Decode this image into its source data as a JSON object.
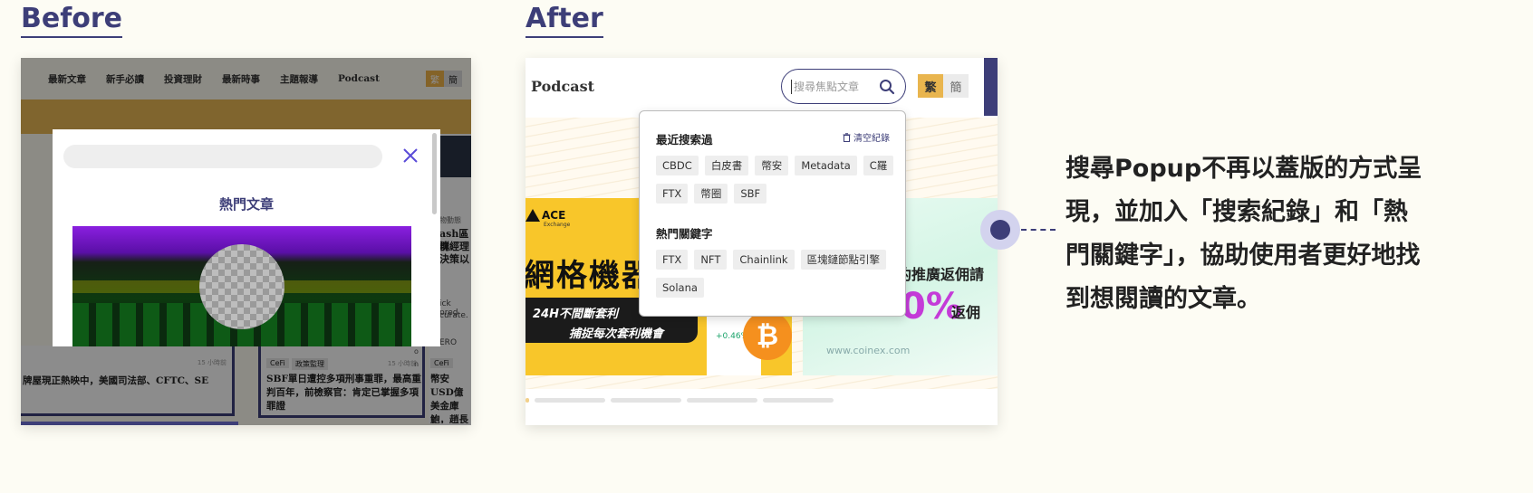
{
  "headings": {
    "before": "Before",
    "after": "After"
  },
  "before": {
    "nav": [
      "最新文章",
      "新手必讀",
      "投資理財",
      "最新時事",
      "主題報導",
      "Podcast"
    ],
    "lang": {
      "trad": "繁",
      "simp": "簡"
    },
    "modal": {
      "section_title": "熱門文章"
    },
    "side_snippets": [
      "ash區塊",
      "群經理",
      "決策以"
    ],
    "side_small": [
      "物動態",
      "ick pred",
      "curate.",
      "ERO"
    ],
    "cards": [
      {
        "time": "15 小時前",
        "title": "牌屋現正熱映中，美國司法部、CFTC、SE"
      },
      {
        "tags": [
          "CeFi",
          "政策監理"
        ],
        "time": "15 小時前",
        "title": "SBF單日遭控多項刑事重罪，最高重判百年，前檢察官：肯定已掌握多項罪證"
      },
      {
        "tags": [
          "CeFi"
        ],
        "title": "幣安USD億美金庫鮑，趙長推神秘預"
      }
    ]
  },
  "after": {
    "logo": "Podcast",
    "search_placeholder": "搜尋焦點文章",
    "lang": {
      "trad": "繁",
      "simp": "簡"
    },
    "popup": {
      "recent_title": "最近搜索過",
      "clear_label": "清空紀錄",
      "recent_tags": [
        "CBDC",
        "白皮書",
        "幣安",
        "Metadata",
        "C羅",
        "FTX",
        "幣圈",
        "SBF"
      ],
      "hot_title": "熱門關鍵字",
      "hot_tags": [
        "FTX",
        "NFT",
        "Chainlink",
        "區塊鏈節點引擎",
        "Solana"
      ]
    },
    "ad_left": {
      "brand": "ACE",
      "brand_sub": "Exchange",
      "headline": "網格機器",
      "line1": "24H不間斷套利",
      "line2": "捕捉每次套利機會",
      "pct": "+0.46%"
    },
    "ad_right": {
      "text1": "約推廣返佣請",
      "pct": "0%",
      "text2": "返佣",
      "url": "www.coinex.com"
    }
  },
  "description": "搜尋Popup不再以蓋版的方式呈現，並加入「搜索紀錄」和「熱門關鍵字」，協助使用者更好地找到想閱讀的文章。",
  "colors": {
    "accent": "#3d3e78",
    "lang_active": "#e9b54e",
    "background": "#fdfcf4"
  }
}
